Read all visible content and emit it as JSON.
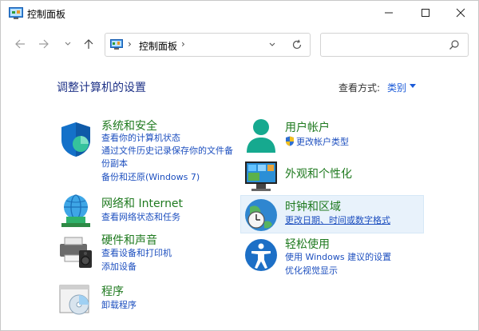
{
  "window": {
    "title": "控制面板"
  },
  "address": {
    "crumb": "控制面板"
  },
  "search": {
    "placeholder": "",
    "value": ""
  },
  "header": {
    "title": "调整计算机的设置",
    "view_by_label": "查看方式:",
    "view_by_value": "类别"
  },
  "categories": {
    "system": {
      "title": "系统和安全",
      "links": [
        "查看你的计算机状态",
        "通过文件历史记录保存你的文件备",
        "份副本",
        "备份和还原(Windows 7)"
      ]
    },
    "network": {
      "title": "网络和 Internet",
      "links": [
        "查看网络状态和任务"
      ]
    },
    "hardware": {
      "title": "硬件和声音",
      "links": [
        "查看设备和打印机",
        "添加设备"
      ]
    },
    "programs": {
      "title": "程序",
      "links": [
        "卸载程序"
      ]
    },
    "user": {
      "title": "用户帐户",
      "links": [
        "更改帐户类型"
      ]
    },
    "appearance": {
      "title": "外观和个性化",
      "links": []
    },
    "clock": {
      "title": "时钟和区域",
      "links": [
        "更改日期、时间或数字格式"
      ]
    },
    "ease": {
      "title": "轻松使用",
      "links": [
        "使用 Windows 建议的设置",
        "优化视觉显示"
      ]
    }
  }
}
